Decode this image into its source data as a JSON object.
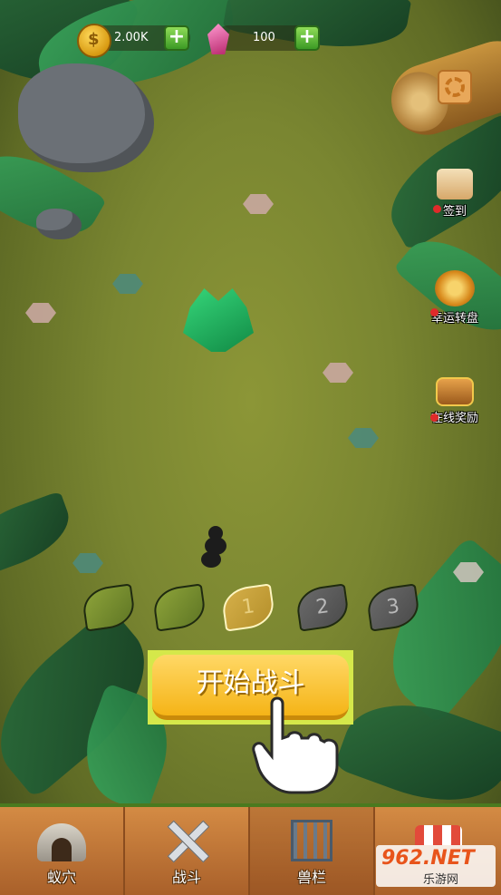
{
  "currency": {
    "coins": "2.00K",
    "gems": "100"
  },
  "side_menu": {
    "signin": "签到",
    "lucky_wheel": "幸运转盘",
    "online_reward": "在线奖励"
  },
  "stages": [
    {
      "label": "",
      "state": "done"
    },
    {
      "label": "",
      "state": "done"
    },
    {
      "label": "1",
      "state": "current"
    },
    {
      "label": "2",
      "state": "locked"
    },
    {
      "label": "3",
      "state": "locked"
    }
  ],
  "start_button": "开始战斗",
  "bottom_nav": {
    "nest": "蚁穴",
    "battle": "战斗",
    "cage": "兽栏"
  },
  "watermark": {
    "brand": "962.NET",
    "sub": "乐游网"
  },
  "colors": {
    "ground": "#7a8631",
    "leaf_green": "#3aa35a",
    "button_yellow": "#f5b417",
    "nav_wood": "#d48b44"
  }
}
